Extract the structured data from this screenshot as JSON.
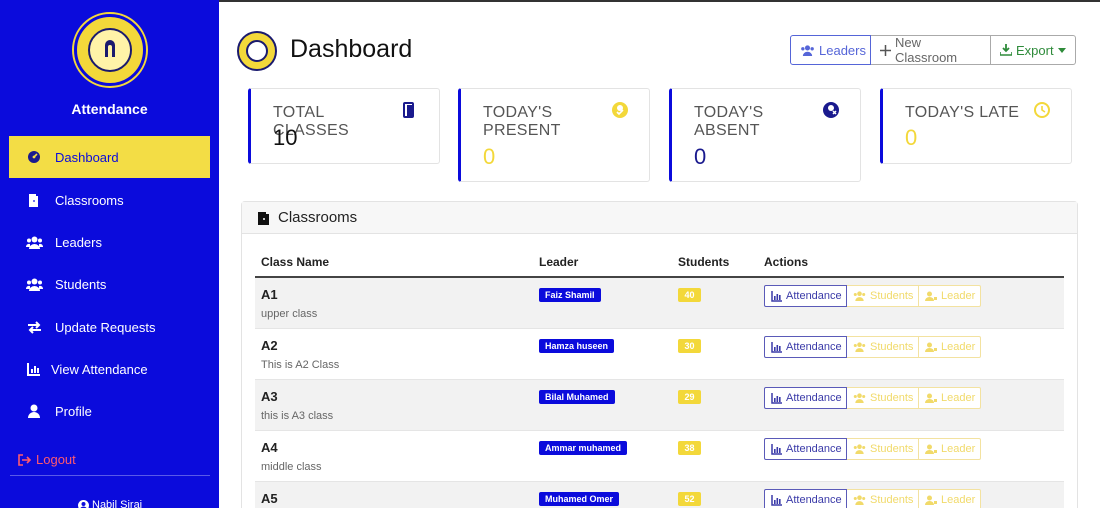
{
  "sidebar": {
    "title": "Attendance",
    "items": [
      {
        "label": "Dashboard",
        "icon": "tachometer-icon"
      },
      {
        "label": "Classrooms",
        "icon": "door-icon"
      },
      {
        "label": "Leaders",
        "icon": "users-icon"
      },
      {
        "label": "Students",
        "icon": "users-icon"
      },
      {
        "label": "Update Requests",
        "icon": "exchange-icon"
      },
      {
        "label": "View Attendance",
        "icon": "chart-icon"
      },
      {
        "label": "Profile",
        "icon": "user-icon"
      }
    ],
    "logout": "Logout",
    "user": "Nabil Siraj"
  },
  "header": {
    "title": "Dashboard",
    "buttons": {
      "leaders": "Leaders",
      "new_classroom": "New Classroom",
      "export": "Export"
    }
  },
  "stats": [
    {
      "label": "TOTAL CLASSES",
      "value": "10"
    },
    {
      "label": "TODAY'S PRESENT",
      "value": "0"
    },
    {
      "label": "TODAY'S ABSENT",
      "value": "0"
    },
    {
      "label": "TODAY'S LATE",
      "value": "0"
    }
  ],
  "classrooms": {
    "title": "Classrooms",
    "columns": [
      "Class Name",
      "Leader",
      "Students",
      "Actions"
    ],
    "actions": {
      "attendance": "Attendance",
      "students": "Students",
      "leader": "Leader"
    },
    "rows": [
      {
        "name": "A1",
        "desc": "upper class",
        "leader": "Faiz Shamil",
        "students": "40"
      },
      {
        "name": "A2",
        "desc": "This is A2 Class",
        "leader": "Hamza huseen",
        "students": "30"
      },
      {
        "name": "A3",
        "desc": "this is A3 class",
        "leader": "Bilal Muhamed",
        "students": "29"
      },
      {
        "name": "A4",
        "desc": "middle class",
        "leader": "Ammar muhamed",
        "students": "38"
      },
      {
        "name": "A5",
        "desc": "",
        "leader": "Muhamed Omer",
        "students": "52"
      }
    ]
  },
  "colors": {
    "sidebar": "#0b0bdc",
    "accent": "#f3dd45",
    "logout": "#ff5a6e"
  }
}
